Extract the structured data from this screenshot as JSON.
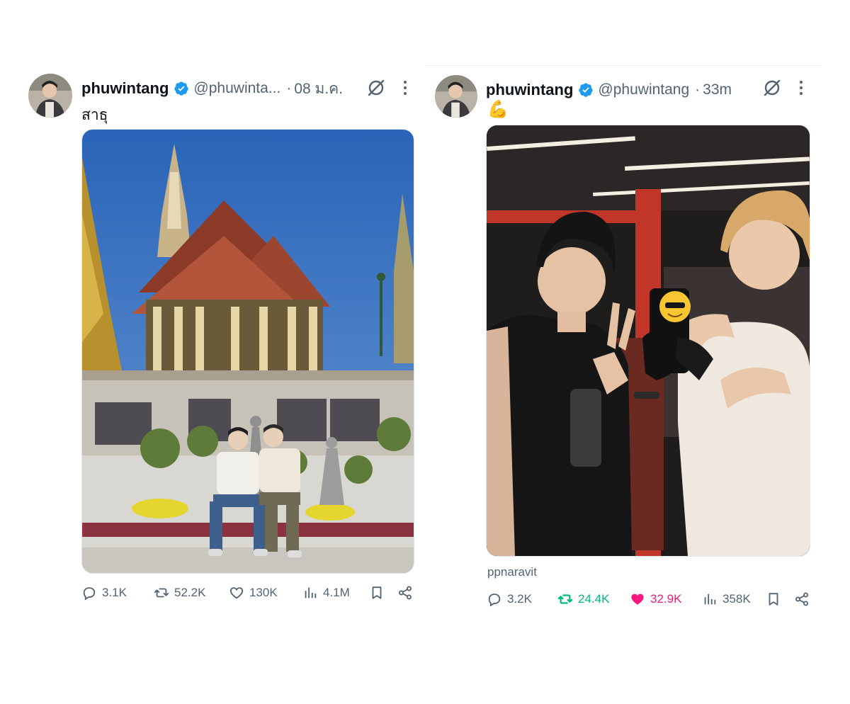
{
  "left_post": {
    "display_name": "phuwintang",
    "handle": "@phuwinta...",
    "separator": "·",
    "time": "08 ม.ค.",
    "text": "สาธุ",
    "media_icon": "photo-temple",
    "stats": {
      "replies": "3.1K",
      "reposts": "52.2K",
      "likes": "130K",
      "views": "4.1M"
    }
  },
  "right_post": {
    "display_name": "phuwintang",
    "handle": "@phuwintang",
    "separator": "·",
    "time": "33m",
    "text": "💪",
    "media_icon": "photo-gym-mirror",
    "caption": "ppnaravit",
    "stats": {
      "replies": "3.2K",
      "reposts": "24.4K",
      "likes": "32.9K",
      "views": "358K"
    }
  },
  "icons": {
    "verified": "verified-badge-icon",
    "grok": "grok-icon",
    "more": "more-icon",
    "reply": "reply-icon",
    "repost": "repost-icon",
    "like": "heart-icon",
    "views": "views-icon",
    "bookmark": "bookmark-icon",
    "share": "share-icon"
  },
  "colors": {
    "text_primary": "#0f1419",
    "text_secondary": "#536471",
    "verified_blue": "#1d9bf0",
    "repost_green": "#00ba7c",
    "like_pink": "#f91880"
  }
}
